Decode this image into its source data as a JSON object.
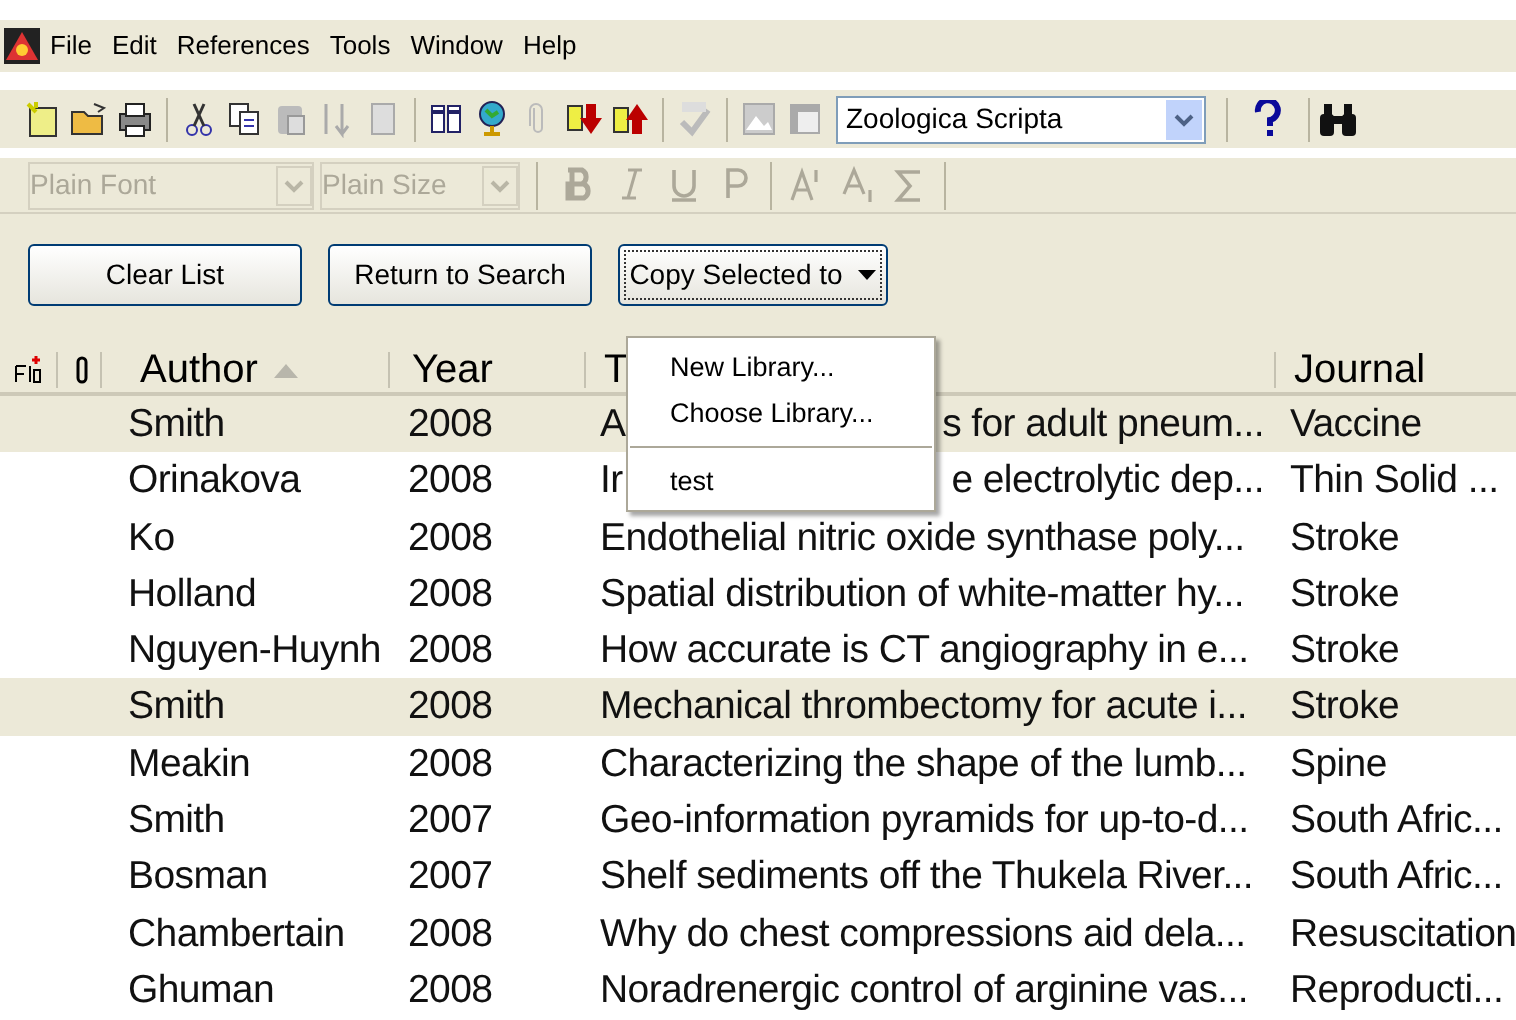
{
  "menu_bar": [
    "File",
    "Edit",
    "References",
    "Tools",
    "Window",
    "Help"
  ],
  "toolbar": {
    "style_select": "Zoologica Scripta"
  },
  "format_bar": {
    "font_select": "Plain Font",
    "size_select": "Plain Size",
    "disabled": true
  },
  "buttons": [
    {
      "label": "Clear List",
      "focused": false
    },
    {
      "label": "Return to Search",
      "focused": false
    },
    {
      "label": "Copy Selected to",
      "focused": true
    }
  ],
  "copy_menu": {
    "items": [
      {
        "kind": "item",
        "label": "New Library..."
      },
      {
        "kind": "item",
        "label": "Choose Library..."
      },
      {
        "kind": "separator"
      },
      {
        "kind": "item",
        "label": "test"
      }
    ]
  },
  "table": {
    "columns": [
      {
        "label": "Author",
        "sorted": true
      },
      {
        "label": "Year",
        "sorted": false
      },
      {
        "label": "T",
        "sorted": false
      },
      {
        "label": "Journal",
        "sorted": false
      }
    ],
    "rows": [
      {
        "author": "Smith",
        "year": "2008",
        "title_start": "A",
        "title_end": "s for adult pneum...",
        "journal": "Vaccine",
        "selected": true
      },
      {
        "author": "Orinakova",
        "year": "2008",
        "title_start": "Ir",
        "title_end": "e electrolytic dep...",
        "journal": "Thin Solid ...",
        "selected": false
      },
      {
        "author": "Ko",
        "year": "2008",
        "title": "Endothelial nitric oxide synthase poly...",
        "journal": "Stroke",
        "selected": false
      },
      {
        "author": "Holland",
        "year": "2008",
        "title": "Spatial distribution of white-matter hy...",
        "journal": "Stroke",
        "selected": false
      },
      {
        "author": "Nguyen-Huynh",
        "year": "2008",
        "title": "How accurate is CT angiography in e...",
        "journal": "Stroke",
        "selected": false
      },
      {
        "author": "Smith",
        "year": "2008",
        "title": "Mechanical thrombectomy for acute i...",
        "journal": "Stroke",
        "selected": true
      },
      {
        "author": "Meakin",
        "year": "2008",
        "title": "Characterizing the shape of the lumb...",
        "journal": "Spine",
        "selected": false
      },
      {
        "author": "Smith",
        "year": "2007",
        "title": "Geo-information pyramids for up-to-d...",
        "journal": "South Afric...",
        "selected": false
      },
      {
        "author": "Bosman",
        "year": "2007",
        "title": "Shelf sediments off the Thukela River...",
        "journal": "South Afric...",
        "selected": false
      },
      {
        "author": "Chambertain",
        "year": "2008",
        "title": "Why do chest compressions aid dela...",
        "journal": "Resuscitation",
        "selected": false
      },
      {
        "author": "Ghuman",
        "year": "2008",
        "title": "Noradrenergic control of arginine vas...",
        "journal": "Reproducti...",
        "selected": false
      }
    ]
  }
}
